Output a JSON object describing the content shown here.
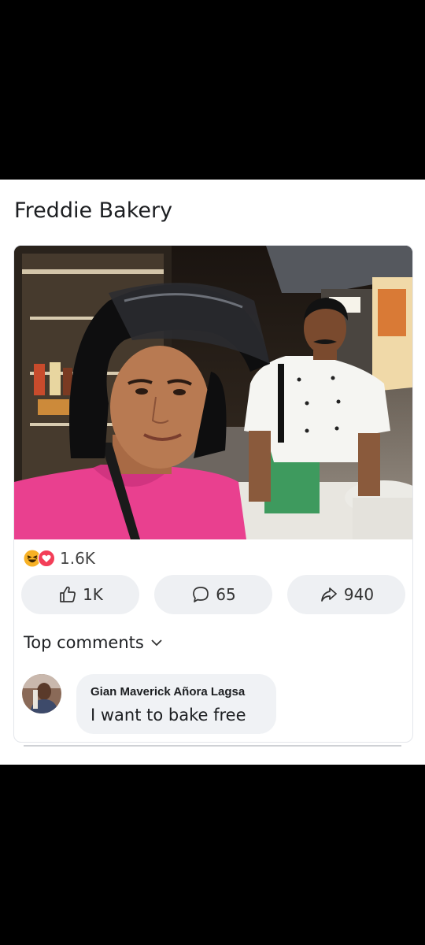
{
  "post": {
    "author": "Freddie Bakery",
    "photo_alt": "Selfie of a young man in a pink shirt and black helmet with a chef in a white coat and green apron"
  },
  "reactions": {
    "icons": [
      "haha-icon",
      "love-icon"
    ],
    "count": "1.6K"
  },
  "actions": {
    "like_count": "1K",
    "comment_count": "65",
    "share_count": "940"
  },
  "comments": {
    "sort_label": "Top comments",
    "items": [
      {
        "author": "Gian Maverick Añora Lagsa",
        "text": "I want to bake free"
      }
    ]
  },
  "colors": {
    "love": "#f33e58",
    "haha": "#f7b125",
    "pill_bg": "#eef0f3"
  }
}
